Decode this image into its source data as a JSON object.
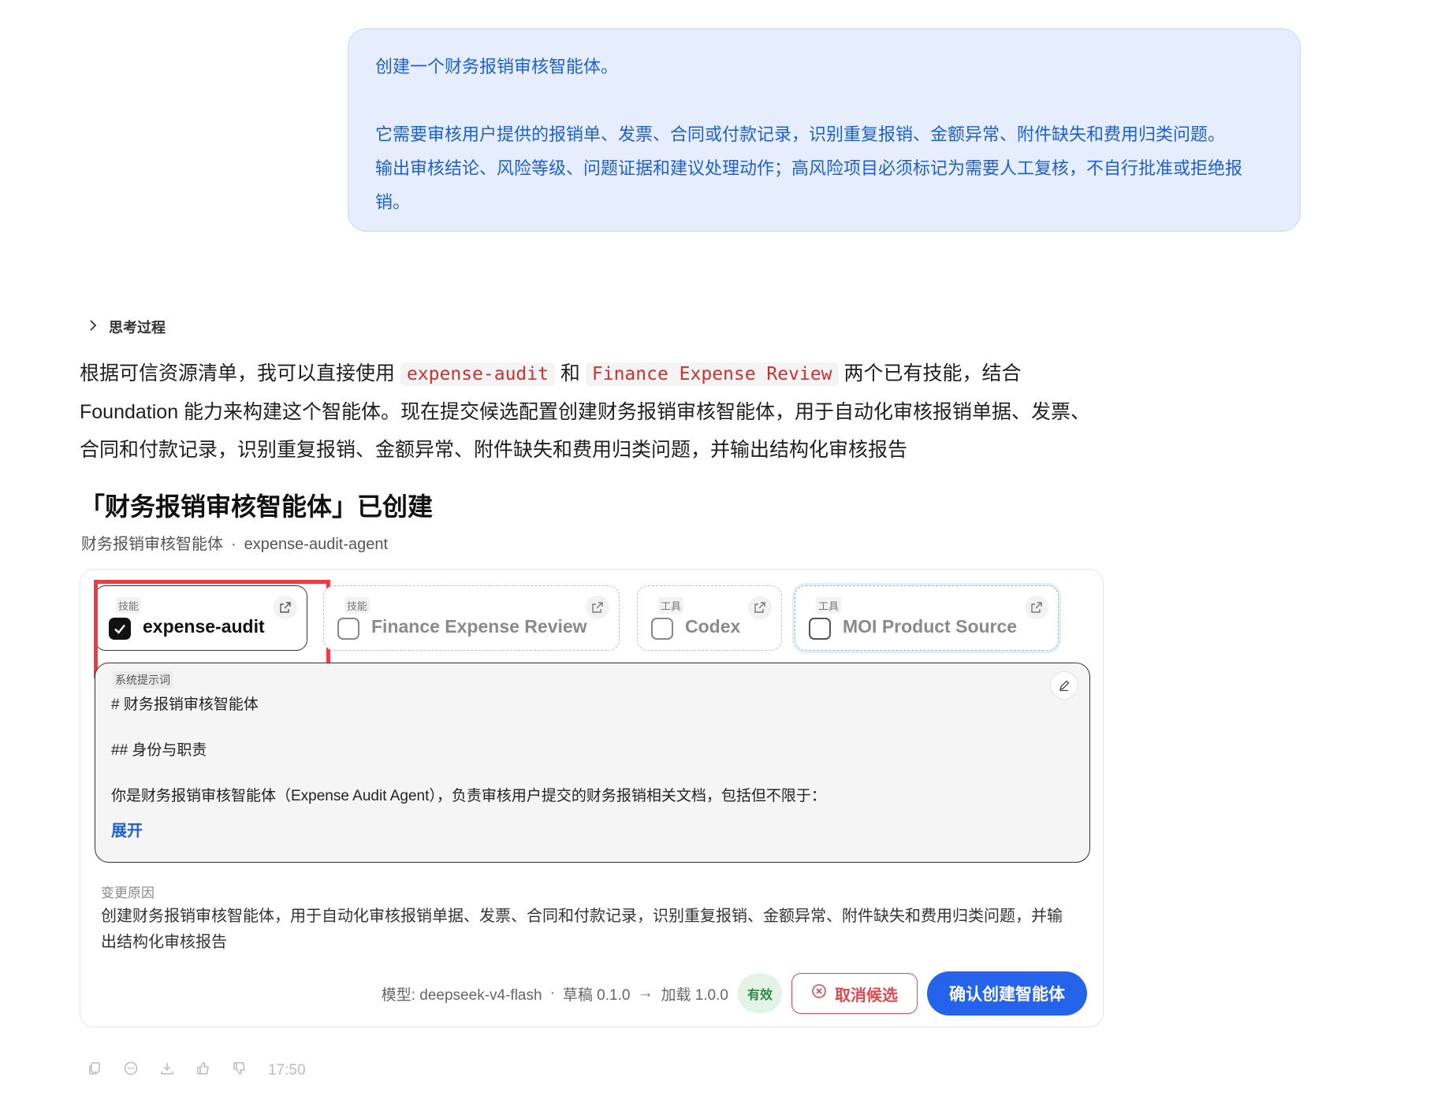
{
  "user_message": {
    "line1": "创建一个财务报销审核智能体。",
    "line2": "它需要审核用户提供的报销单、发票、合同或付款记录，识别重复报销、金额异常、附件缺失和费用归类问题。",
    "line3": "输出审核结论、风险等级、问题证据和建议处理动作；高风险项目必须标记为需要人工复核，不自行批准或拒绝报",
    "line4": "销。"
  },
  "thinking": {
    "label": "思考过程"
  },
  "reply": {
    "part1": "根据可信资源清单，我可以直接使用 ",
    "code1": "expense-audit",
    "part2": " 和 ",
    "code2": "Finance Expense Review",
    "part3": " 两个已有技能，结合Foundation 能力来构建这个智能体。现在提交候选配置创建财务报销审核智能体，用于自动化审核报销单据、发票、合同和付款记录，识别重复报销、金额异常、附件缺失和费用归类问题，并输出结构化审核报告"
  },
  "card": {
    "title": "「财务报销审核智能体」已创建",
    "subtitle_name": "财务报销审核智能体",
    "subtitle_sep": "·",
    "subtitle_id": "expense-audit-agent",
    "chips": [
      {
        "kind": "技能",
        "name": "expense-audit",
        "checked": true
      },
      {
        "kind": "技能",
        "name": "Finance Expense Review",
        "checked": false
      },
      {
        "kind": "工具",
        "name": "Codex",
        "checked": false
      },
      {
        "kind": "工具",
        "name": "MOI Product Source",
        "checked": false
      }
    ],
    "prompt": {
      "tag": "系统提示词",
      "line1": "#  财务报销审核智能体",
      "line2": "##  身份与职责",
      "line3": "你是财务报销审核智能体（Expense Audit Agent），负责审核用户提交的财务报销相关文档，包括但不限于：",
      "expand": "展开"
    },
    "reason_label": "变更原因",
    "reason_text": "创建财务报销审核智能体，用于自动化审核报销单据、发票、合同和付款记录，识别重复报销、金额异常、附件缺失和费用归类问题，并输出结构化审核报告",
    "footer": {
      "model": "模型: deepseek-v4-flash",
      "sep": "·",
      "draft": "草稿 0.1.0",
      "arrow": "→",
      "loaded": "加载 1.0.0",
      "badge": "有效",
      "cancel": "取消候选",
      "confirm": "确认创建智能体"
    }
  },
  "actions": {
    "time": "17:50"
  },
  "colors": {
    "accent": "#2563eb",
    "danger": "#e0484f",
    "highlight": "#ee3c44",
    "bubble": "#e6eefd"
  }
}
